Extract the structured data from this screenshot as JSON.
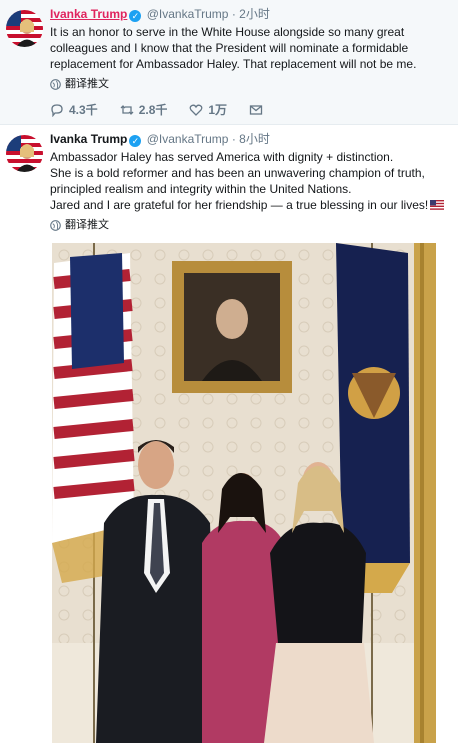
{
  "tweets": [
    {
      "author_name": "Ivanka Trump",
      "handle": "@IvankaTrump",
      "dot": "·",
      "time": "2小时",
      "lines": [
        "It is an honor to serve in the White House alongside so many great",
        "colleagues and I know that the President will nominate a formidable",
        "replacement for Ambassador Haley. That replacement will not be me."
      ],
      "translate_label": "翻译推文",
      "reply_count": "",
      "retweet_count": "2.8千",
      "reply_label": "4.3千",
      "like_count": "1万"
    },
    {
      "author_name": "Ivanka Trump",
      "handle": "@IvankaTrump",
      "dot": "·",
      "time": "8小时",
      "lines": [
        "Ambassador Haley has served America with dignity + distinction.",
        "She is a bold reformer and has been an unwavering champion of truth,",
        "principled realism and integrity within the United Nations.",
        "Jared and I are grateful for her friendship — a true blessing in our lives!"
      ],
      "translate_label": "翻译推文"
    }
  ],
  "icons": {
    "verified": "verified-badge-icon",
    "reply": "reply-icon",
    "retweet": "retweet-icon",
    "like": "heart-icon",
    "dm": "message-icon",
    "globe": "globe-icon",
    "flag": "us-flag-emoji"
  },
  "colors": {
    "name_highlight": "#e0245e",
    "verified": "#1da1f2",
    "muted": "#657786",
    "highlight_bg": "#f5f8fa"
  }
}
